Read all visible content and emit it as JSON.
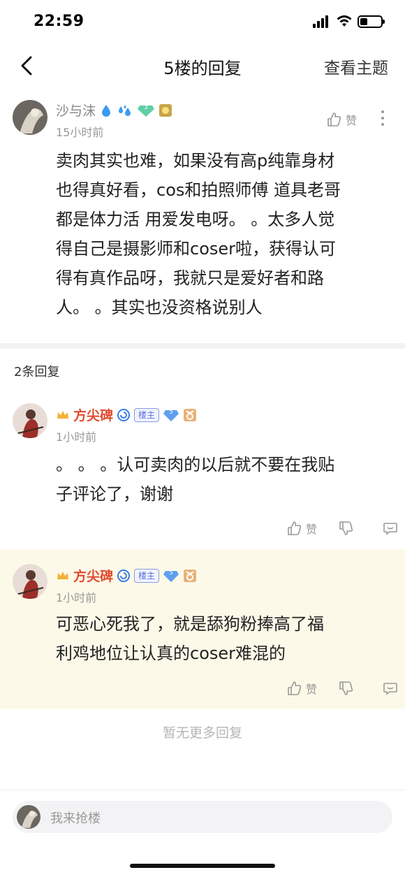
{
  "status_bar": {
    "time": "22:59"
  },
  "nav": {
    "title": "5楼的回复",
    "right_label": "查看主题"
  },
  "post": {
    "author": "沙与沫",
    "time": "15小时前",
    "like_label": "赞",
    "lines": [
      "卖肉其实也难，如果没有高p纯靠身材",
      "也得真好看，cos和拍照师傅 道具老哥",
      "都是体力活 用爱发电呀。 。太多人觉",
      "得自己是摄影师和coser啦，获得认可",
      "得有真作品呀，我就只是爱好者和路",
      "人。 。其实也没资格说别人"
    ],
    "level_badge": "3"
  },
  "replies_header": "2条回复",
  "replies": [
    {
      "author": "方尖碑",
      "host_tag": "楼主",
      "level_badge": "5",
      "time": "1小时前",
      "lines": [
        "。 。 。认可卖肉的以后就不要在我贴",
        "子评论了，谢谢"
      ],
      "like_label": "赞"
    },
    {
      "author": "方尖碑",
      "host_tag": "楼主",
      "level_badge": "5",
      "time": "1小时前",
      "lines": [
        "可恶心死我了，就是舔狗粉捧高了福",
        "利鸡地位让认真的coser难混的"
      ],
      "like_label": "赞"
    }
  ],
  "no_more": "暂无更多回复",
  "input": {
    "placeholder": "我来抢楼"
  },
  "colors": {
    "accent_red": "#e04a2f",
    "highlight_bg": "#fdf9e8",
    "host_tag": "#5a6fd8"
  }
}
